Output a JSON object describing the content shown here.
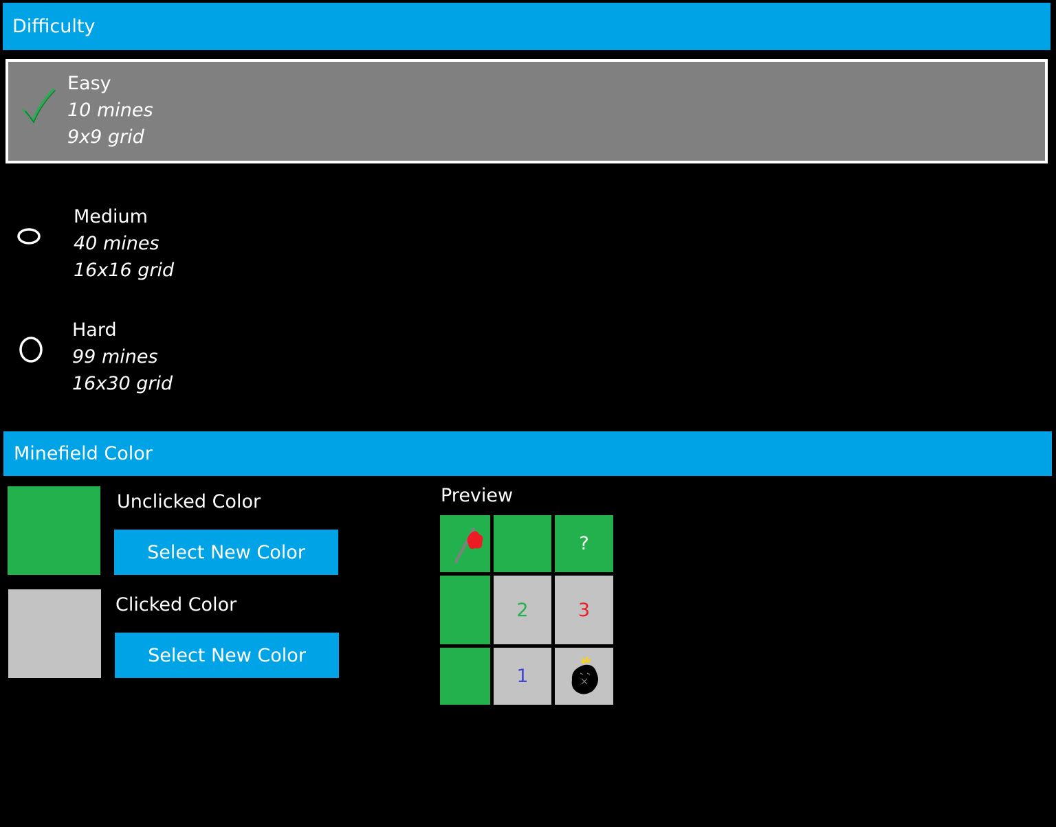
{
  "difficulty": {
    "header": "Difficulty",
    "options": [
      {
        "title": "Easy",
        "mines": "10 mines",
        "grid": "9x9 grid",
        "selected": true,
        "icon": "checkmark-icon"
      },
      {
        "title": "Medium",
        "mines": "40 mines",
        "grid": "16x16 grid",
        "selected": false,
        "icon": "radio-circle-icon"
      },
      {
        "title": "Hard",
        "mines": "99 mines",
        "grid": "16x30 grid",
        "selected": false,
        "icon": "radio-circle-icon"
      }
    ]
  },
  "minefield_color": {
    "header": "Minefield Color",
    "unclicked": {
      "label": "Unclicked Color",
      "button": "Select New Color",
      "color": "#22b14c"
    },
    "clicked": {
      "label": "Clicked Color",
      "button": "Select New Color",
      "color": "#c3c3c3"
    }
  },
  "preview": {
    "label": "Preview",
    "cells": [
      {
        "content": "",
        "type": "flag"
      },
      {
        "content": "",
        "type": "unclicked"
      },
      {
        "content": "?",
        "type": "unclicked",
        "color": "#ffffff"
      },
      {
        "content": "",
        "type": "unclicked"
      },
      {
        "content": "2",
        "type": "clicked",
        "color": "#22b14c"
      },
      {
        "content": "3",
        "type": "clicked",
        "color": "#ed1c24"
      },
      {
        "content": "",
        "type": "unclicked"
      },
      {
        "content": "1",
        "type": "clicked",
        "color": "#3f48cc"
      },
      {
        "content": "",
        "type": "mine"
      }
    ]
  },
  "colors": {
    "accent": "#00a3e6",
    "selected_bg": "#808080",
    "check": "#22b14c"
  }
}
